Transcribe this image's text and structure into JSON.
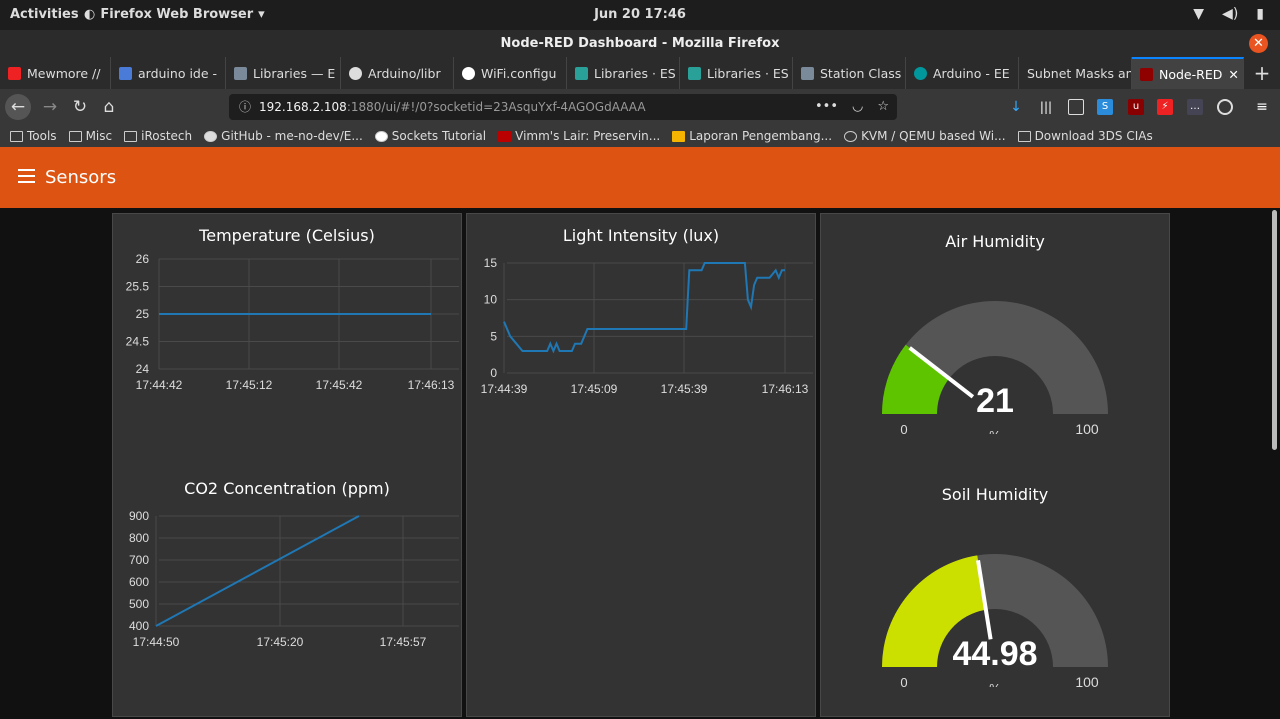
{
  "topbar": {
    "activities": "Activities",
    "app": "Firefox Web Browser",
    "clock": "Jun 20  17:46"
  },
  "window": {
    "title": "Node-RED Dashboard - Mozilla Firefox"
  },
  "tabs": [
    {
      "label": "Mewmore //",
      "color": "#e22"
    },
    {
      "label": "arduino ide -",
      "color": "#4a7bd8"
    },
    {
      "label": "Libraries — E",
      "color": "#7a8a9a"
    },
    {
      "label": "Arduino/libr",
      "color": "#222"
    },
    {
      "label": "WiFi.configu",
      "color": "#4285f4"
    },
    {
      "label": "Libraries · ES",
      "color": "#2aa198"
    },
    {
      "label": "Libraries · ES",
      "color": "#2aa198"
    },
    {
      "label": "Station Class",
      "color": "#7a8a9a"
    },
    {
      "label": "Arduino - EE",
      "color": "#00979d"
    },
    {
      "label": "Subnet Masks an",
      "color": ""
    },
    {
      "label": "Node-RED",
      "color": "#8f0000"
    }
  ],
  "navbar": {
    "url_host": "192.168.2.108",
    "url_path": ":1880/ui/#!/0?socketid=23AsquYxf-4AGOGdAAAA"
  },
  "bookmarks": [
    "Tools",
    "Misc",
    "iRostech",
    "GitHub - me-no-dev/E...",
    "Sockets Tutorial",
    "Vimm's Lair: Preservin...",
    "Laporan Pengembang...",
    "KVM / QEMU based Wi...",
    "Download 3DS CIAs"
  ],
  "dashboard": {
    "title": "Sensors",
    "accent": "#dd5412",
    "card_bg": "#333333"
  },
  "chart_data": [
    {
      "type": "line",
      "title": "Temperature (Celsius)",
      "ylim": [
        24,
        26
      ],
      "yticks": [
        "26",
        "25.5",
        "25",
        "24.5",
        "24"
      ],
      "xticks": [
        "17:44:42",
        "17:45:12",
        "17:45:42",
        "17:46:13"
      ],
      "x": [
        0,
        91
      ],
      "values": [
        25,
        25
      ],
      "color": "#1f77b4"
    },
    {
      "type": "line",
      "title": "Light Intensity (lux)",
      "ylim": [
        0,
        15
      ],
      "yticks": [
        "15",
        "10",
        "5",
        "0"
      ],
      "xticks": [
        "17:44:39",
        "17:45:09",
        "17:45:39",
        "17:46:13"
      ],
      "x": [
        0,
        2,
        4,
        6,
        10,
        14,
        15,
        16,
        17,
        18,
        20,
        22,
        23,
        25,
        27,
        30,
        40,
        50,
        59,
        59.5,
        60,
        64,
        65,
        70,
        75,
        78,
        79,
        80,
        81,
        82,
        84,
        86,
        88,
        89,
        90,
        91
      ],
      "values": [
        7,
        5,
        4,
        3,
        3,
        3,
        4,
        3,
        4,
        3,
        3,
        3,
        4,
        4,
        6,
        6,
        6,
        6,
        6,
        10,
        14,
        14,
        15,
        15,
        15,
        15,
        10,
        9,
        12,
        13,
        13,
        13,
        14,
        13,
        14,
        14
      ],
      "color": "#1f77b4"
    },
    {
      "type": "line",
      "title": "CO2 Concentration (ppm)",
      "ylim": [
        400,
        900
      ],
      "yticks": [
        "900",
        "800",
        "700",
        "600",
        "500",
        "400"
      ],
      "xticks": [
        "17:44:50",
        "17:45:20",
        "17:45:57"
      ],
      "x": [
        0,
        62
      ],
      "values": [
        400,
        900
      ],
      "color": "#1f77b4"
    }
  ],
  "gauges": [
    {
      "title": "Air Humidity",
      "value": "21",
      "value_num": 21,
      "min": "0",
      "max": "100",
      "unit": "%",
      "color": "#5ec400"
    },
    {
      "title": "Soil Humidity",
      "value": "44.98",
      "value_num": 44.98,
      "min": "0",
      "max": "100",
      "unit": "%",
      "color": "#cce000"
    }
  ]
}
